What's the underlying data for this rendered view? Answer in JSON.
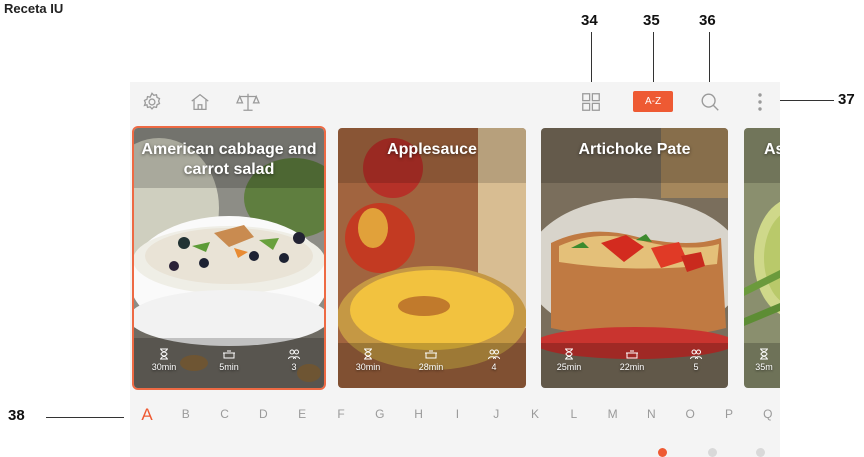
{
  "document": {
    "title": "Receta IU"
  },
  "callouts": [
    "34",
    "35",
    "36",
    "37",
    "38"
  ],
  "toolbar": {
    "left_icons": [
      "settings-icon",
      "home-icon",
      "scale-icon"
    ],
    "right_icons": [
      "grid-view-icon",
      "az-sort-button",
      "search-icon",
      "more-vertical-icon"
    ],
    "sort_label": "A-Z"
  },
  "recipes": [
    {
      "title": "American cabbage and carrot salad",
      "prep_time": "30min",
      "cook_time": "5min",
      "servings": "3",
      "selected": true
    },
    {
      "title": "Applesauce",
      "prep_time": "30min",
      "cook_time": "28min",
      "servings": "4",
      "selected": false
    },
    {
      "title": "Artichoke Pate",
      "prep_time": "25min",
      "cook_time": "22min",
      "servings": "5",
      "selected": false
    },
    {
      "title": "As",
      "prep_time": "35m",
      "cook_time": "",
      "servings": "",
      "selected": false
    }
  ],
  "alphabet": [
    "A",
    "B",
    "C",
    "D",
    "E",
    "F",
    "G",
    "H",
    "I",
    "J",
    "K",
    "L",
    "M",
    "N",
    "O",
    "P",
    "Q"
  ],
  "active_letter": "A",
  "pagination": {
    "total": 3,
    "active": 1
  },
  "colors": {
    "accent": "#ee5a33",
    "screen_bg": "#f4f4f4",
    "icon": "#9a9a9a"
  }
}
